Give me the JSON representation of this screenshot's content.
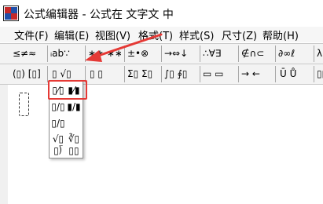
{
  "window": {
    "title": "公式编辑器 - 公式在 文字文 中",
    "accent_colors": {
      "highlight": "#e53935",
      "arrow": "#e53935"
    }
  },
  "menubar": {
    "items": [
      {
        "label": "文件(F)"
      },
      {
        "label": "编辑(E)"
      },
      {
        "label": "视图(V)"
      },
      {
        "label": "格式(T)"
      },
      {
        "label": "样式(S)"
      },
      {
        "label": "尺寸(Z)"
      },
      {
        "label": "帮助(H)"
      }
    ]
  },
  "toolbar_row1": {
    "groups": [
      {
        "label": "≤≠≈"
      },
      {
        "label": "ᵢab∵"
      },
      {
        "label": "∗∗ ∗∗"
      },
      {
        "label": "±•⊗"
      },
      {
        "label": "→⇔↓"
      },
      {
        "label": "∴∀∃"
      },
      {
        "label": "∉∩⊂"
      },
      {
        "label": "∂∞ℓ"
      },
      {
        "label": "λ"
      }
    ]
  },
  "toolbar_row2": {
    "groups": [
      {
        "label": "(▯) [▯]"
      },
      {
        "label": "▯ √▯"
      },
      {
        "label": "▯ ▯"
      },
      {
        "label": "Σ▯ Σ▯"
      },
      {
        "label": "∫▯ ∮▯"
      },
      {
        "label": "▭ ▭"
      },
      {
        "label": "→ ←"
      },
      {
        "label": "Ū Ů"
      },
      {
        "label": "▯▯"
      }
    ]
  },
  "dropdown": {
    "items": [
      {
        "label": "▯⁄▯"
      },
      {
        "label": "▮⁄▮"
      },
      {
        "label": "▯/▯"
      },
      {
        "label": "▮/▮"
      },
      {
        "label": "▯/▯"
      },
      {
        "label": "√▯"
      },
      {
        "label": "∛▯"
      },
      {
        "label": "▯⟌"
      },
      {
        "label": "▯▯"
      }
    ]
  }
}
